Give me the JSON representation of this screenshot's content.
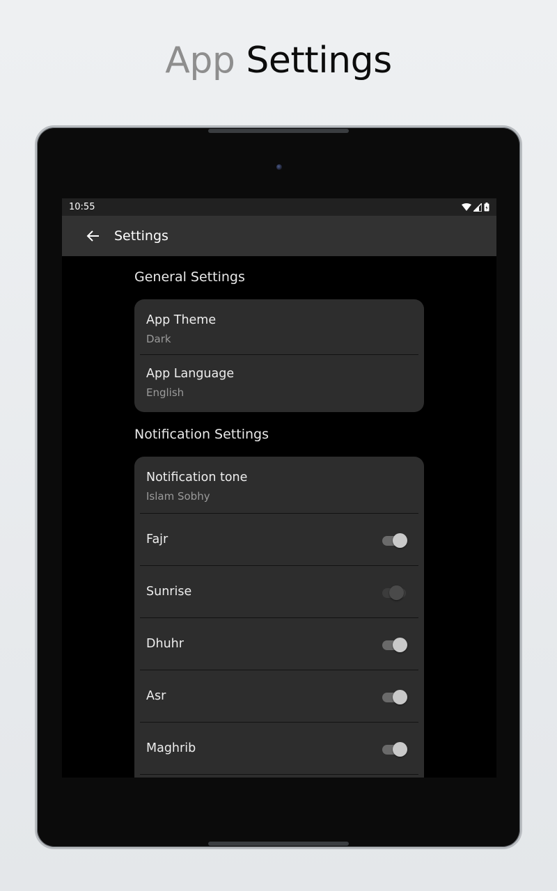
{
  "headline": {
    "word1": "App",
    "word2": "Settings"
  },
  "status_bar": {
    "time": "10:55",
    "icons": [
      "wifi-icon",
      "signal-icon",
      "battery-icon"
    ]
  },
  "app_bar": {
    "back_icon": "arrow-left-icon",
    "title": "Settings"
  },
  "general": {
    "title": "General Settings",
    "items": [
      {
        "title": "App Theme",
        "value": "Dark"
      },
      {
        "title": "App Language",
        "value": "English"
      }
    ]
  },
  "notifications": {
    "title": "Notification Settings",
    "tone": {
      "title": "Notification tone",
      "value": "Islam Sobhy"
    },
    "prayers": [
      {
        "label": "Fajr",
        "enabled": true
      },
      {
        "label": "Sunrise",
        "enabled": false
      },
      {
        "label": "Dhuhr",
        "enabled": true
      },
      {
        "label": "Asr",
        "enabled": true
      },
      {
        "label": "Maghrib",
        "enabled": true
      }
    ]
  },
  "colors": {
    "screen_bg": "#000000",
    "app_bar": "#323232",
    "card": "#2d2d2d",
    "toggle_on_thumb": "#c9c9c9",
    "toggle_off_thumb": "#4a4a4a"
  }
}
